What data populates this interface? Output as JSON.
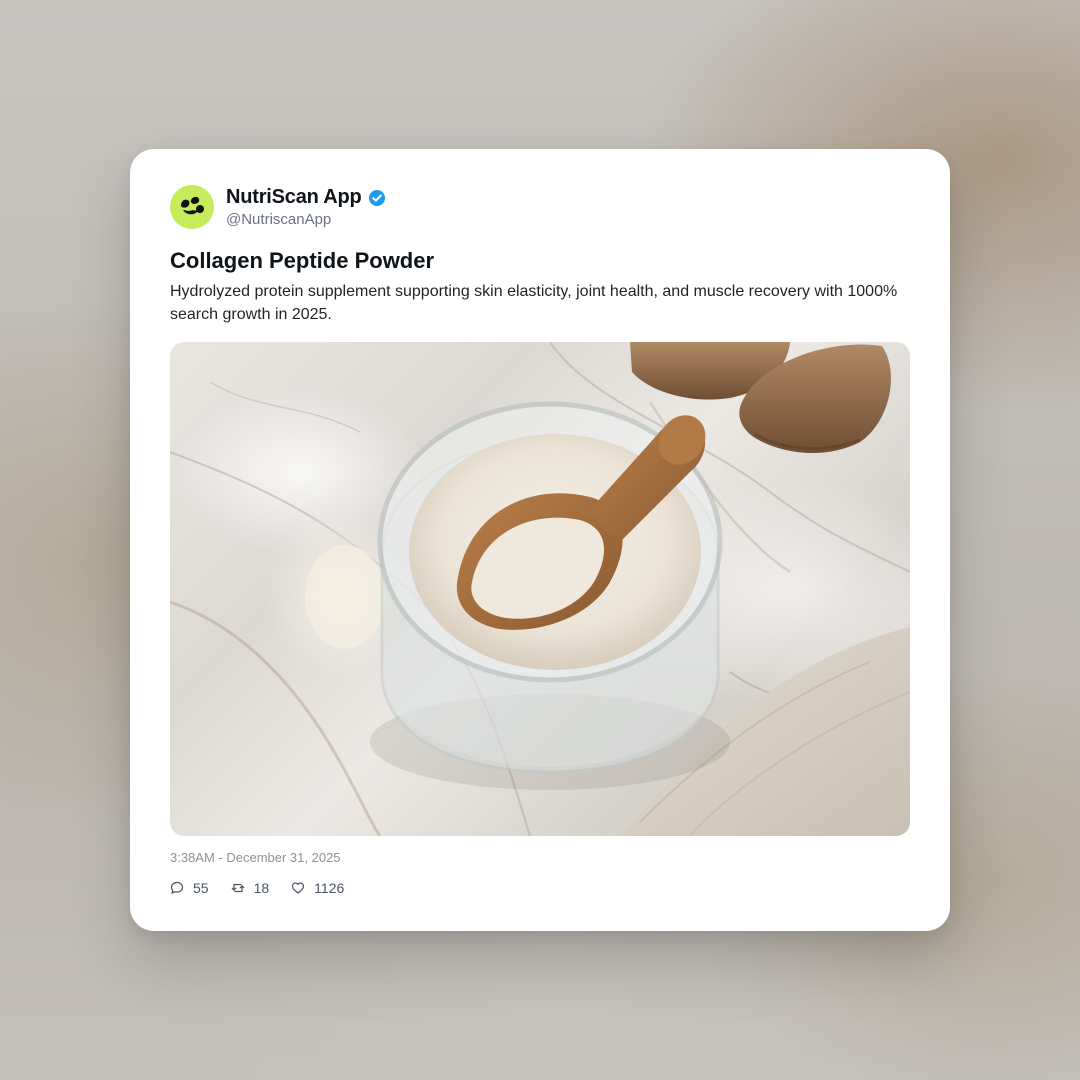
{
  "post": {
    "author": {
      "display_name": "NutriScan App",
      "handle": "@NutriscanApp",
      "verified": true,
      "avatar_color": "#c5ec5a",
      "avatar_icon": "leaf-logo-icon",
      "verified_color": "#1d9bf0"
    },
    "title": "Collagen Peptide Powder",
    "description": "Hydrolyzed protein supplement supporting skin elasticity, joint health, and muscle recovery with 1000% search growth in 2025.",
    "image_icon": "collagen-powder-jar-photo",
    "timestamp": "3:38AM - December 31, 2025",
    "stats": {
      "replies": "55",
      "reposts": "18",
      "likes": "1126"
    }
  }
}
